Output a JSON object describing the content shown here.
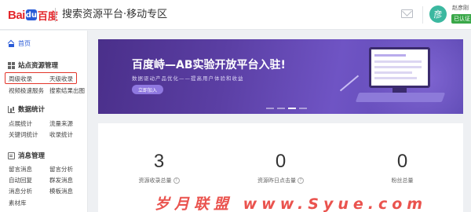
{
  "header": {
    "logo_bai": "Bai",
    "logo_du": "百度",
    "title": "搜索资源平台·移动专区",
    "user_name": "赵彦刚",
    "avatar_char": "彦",
    "verified_badge": "已认证"
  },
  "sidebar": {
    "home": "首页",
    "sections": [
      {
        "title": "站点资源管理",
        "icon": "grid-icon",
        "items": [
          "周级收录",
          "天级收录",
          "视频极速服务",
          "搜索结果出图"
        ]
      },
      {
        "title": "数据统计",
        "icon": "chart-icon",
        "items": [
          "点展统计",
          "流量来源",
          "关键词统计",
          "收录统计"
        ]
      },
      {
        "title": "消息管理",
        "icon": "message-icon",
        "items": [
          "留言消息",
          "留言分析",
          "自动回复",
          "群发消息",
          "消息分析",
          "模板消息",
          "素材库"
        ]
      }
    ]
  },
  "banner": {
    "title": "百度峙—AB实验开放平台入驻!",
    "subtitle": "数据驱动产品优化——提高用户体验和收益",
    "button": "立即加入"
  },
  "stats": [
    {
      "value": "3",
      "label": "资源收录总量"
    },
    {
      "value": "0",
      "label": "资源昨日点击量"
    },
    {
      "value": "0",
      "label": "粉丝总量"
    }
  ],
  "watermark": "岁月联盟 www.Syue.com",
  "colors": {
    "brand_red": "#e3262b",
    "link_blue": "#2a5bd7",
    "highlight_border": "#e2352a",
    "banner_purple": "#5b3fa4",
    "verify_green": "#3aa849"
  }
}
